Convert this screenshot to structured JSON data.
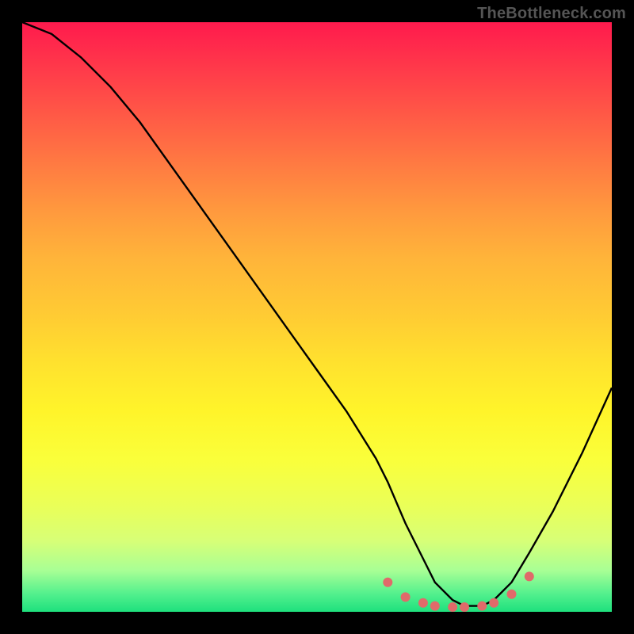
{
  "watermark": "TheBottleneck.com",
  "chart_data": {
    "type": "line",
    "title": "",
    "xlabel": "",
    "ylabel": "",
    "xlim": [
      0,
      100
    ],
    "ylim": [
      0,
      100
    ],
    "series": [
      {
        "name": "bottleneck-curve",
        "x": [
          0,
          5,
          10,
          15,
          20,
          25,
          30,
          35,
          40,
          45,
          50,
          55,
          60,
          62,
          65,
          68,
          70,
          73,
          75,
          78,
          80,
          83,
          86,
          90,
          95,
          100
        ],
        "y": [
          100,
          98,
          94,
          89,
          83,
          76,
          69,
          62,
          55,
          48,
          41,
          34,
          26,
          22,
          15,
          9,
          5,
          2,
          1,
          1,
          2,
          5,
          10,
          17,
          27,
          38
        ]
      }
    ],
    "markers": {
      "name": "optimal-range",
      "x": [
        62,
        65,
        68,
        70,
        73,
        75,
        78,
        80,
        83,
        86
      ],
      "y": [
        5,
        2.5,
        1.5,
        1,
        0.8,
        0.8,
        1,
        1.5,
        3,
        6
      ]
    },
    "colors": {
      "curve": "#000000",
      "marker": "#e06a6a",
      "gradient_top": "#ff1a4d",
      "gradient_mid": "#ffe22e",
      "gradient_bottom": "#1ee07d"
    }
  }
}
